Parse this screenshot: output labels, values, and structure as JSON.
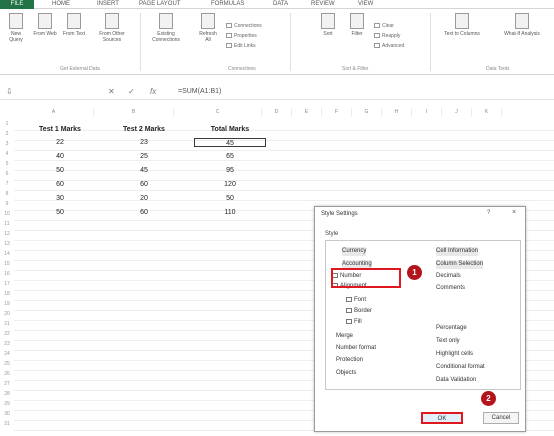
{
  "ribbon": {
    "tabs": [
      "FILE",
      "HOME",
      "INSERT",
      "PAGE LAYOUT",
      "FORMULAS",
      "DATA",
      "REVIEW",
      "VIEW"
    ],
    "buttons": [
      "New Query",
      "From Web",
      "From Text",
      "From Other Sources",
      "Existing Connections",
      "Refresh All",
      "Sort",
      "Filter",
      "Text to Columns",
      "What-If Analysis"
    ],
    "small_items": [
      "Connections",
      "Properties",
      "Edit Links",
      "Clear",
      "Reapply",
      "Advanced"
    ],
    "groups": [
      "Get External Data",
      "Connections",
      "Sort & Filter",
      "Data Tools"
    ]
  },
  "formula_bar": {
    "fx": "fx",
    "content": "=SUM(A1:B1)"
  },
  "grid": {
    "columns": [
      "A",
      "B",
      "C",
      "D",
      "E",
      "F",
      "G",
      "H",
      "I",
      "J",
      "K"
    ],
    "rows": [
      "1",
      "2",
      "3",
      "4",
      "5",
      "6",
      "7",
      "8",
      "9",
      "10",
      "11",
      "12",
      "13",
      "14",
      "15",
      "16",
      "17",
      "18",
      "19",
      "20",
      "21",
      "22",
      "23",
      "24",
      "25",
      "26",
      "27",
      "28",
      "29",
      "30",
      "31"
    ],
    "headers": [
      "Test 1 Marks",
      "Test 2 Marks",
      "Total Marks"
    ],
    "data": [
      [
        "22",
        "23",
        "45"
      ],
      [
        "40",
        "25",
        "65"
      ],
      [
        "50",
        "45",
        "95"
      ],
      [
        "60",
        "60",
        "120"
      ],
      [
        "30",
        "20",
        "50"
      ],
      [
        "50",
        "60",
        "110"
      ]
    ]
  },
  "dialog": {
    "title": "Style Settings",
    "help": "?",
    "close": "×",
    "list_label": "Style",
    "left_items": [
      "Currency",
      "Accounting",
      "Number",
      "Alignment",
      "Font",
      "Border",
      "Fill",
      "Merge",
      "Number format",
      "Protection",
      "Objects"
    ],
    "right_items": [
      "Cell Information",
      "Column Selection",
      "Decimals",
      "Comments",
      "Percentage",
      "Text only",
      "Highlight cells",
      "Conditional format",
      "Data Validation"
    ],
    "ok": "OK",
    "cancel": "Cancel",
    "badges": [
      "1",
      "2"
    ]
  }
}
